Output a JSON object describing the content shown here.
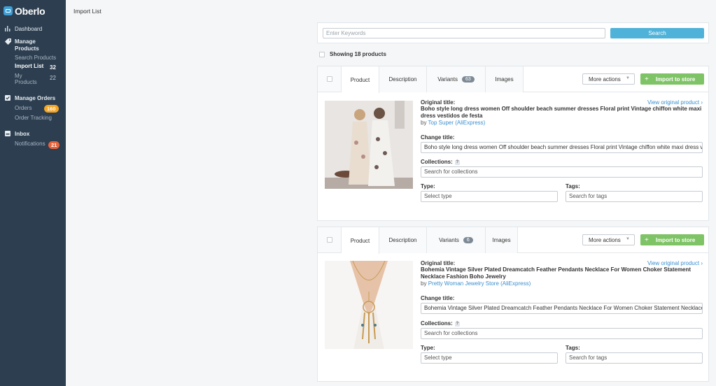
{
  "app": {
    "name": "Oberlo"
  },
  "sidebar": {
    "dashboard": "Dashboard",
    "manage_products": "Manage Products",
    "search_products": "Search Products",
    "import_list": "Import List",
    "import_list_count": "32",
    "my_products": "My Products",
    "my_products_count": "22",
    "manage_orders": "Manage Orders",
    "orders": "Orders",
    "orders_badge": "160",
    "order_tracking": "Order Tracking",
    "inbox": "Inbox",
    "notifications": "Notifications",
    "notifications_badge": "21"
  },
  "page": {
    "title": "Import List"
  },
  "search": {
    "placeholder": "Enter Keywords",
    "button": "Search"
  },
  "showing": "Showing 18 products",
  "tabs": {
    "product": "Product",
    "description": "Description",
    "variants": "Variants",
    "images": "Images"
  },
  "actions": {
    "more": "More actions",
    "import": "Import to store"
  },
  "labels": {
    "original_title": "Original title:",
    "view_original": "View original product",
    "change_title": "Change title:",
    "collections": "Collections:",
    "collections_placeholder": "Search for collections",
    "type": "Type:",
    "type_placeholder": "Select type",
    "tags": "Tags:",
    "tags_placeholder": "Search for tags",
    "by": "by"
  },
  "products": [
    {
      "variants_count": "63",
      "original_title": "Boho style long dress women Off shoulder beach summer dresses Floral print Vintage chiffon white maxi dress vestidos de festa",
      "supplier": "Top Super (AliExpress)",
      "change_title": "Boho style long dress women Off shoulder beach summer dresses Floral print Vintage chiffon white maxi dress vestidos de festa"
    },
    {
      "variants_count": "6",
      "original_title": "Bohemia Vintage Silver Plated Dreamcatch Feather Pendants Necklace For Women Choker Statement Necklace Fashion Boho Jewelry",
      "supplier": "Pretty Woman Jewelry Store (AliExpress)",
      "change_title": "Bohemia Vintage Silver Plated Dreamcatch Feather Pendants Necklace For Women Choker Statement Necklace Fashion Boho Jewelry"
    }
  ],
  "colors": {
    "sidebar_bg": "#2c3e50",
    "search_button": "#4fb3d9",
    "import_button": "#7ec365",
    "orders_badge": "#f5a623",
    "notifications_badge": "#e8633a",
    "link": "#3b8fd0"
  }
}
